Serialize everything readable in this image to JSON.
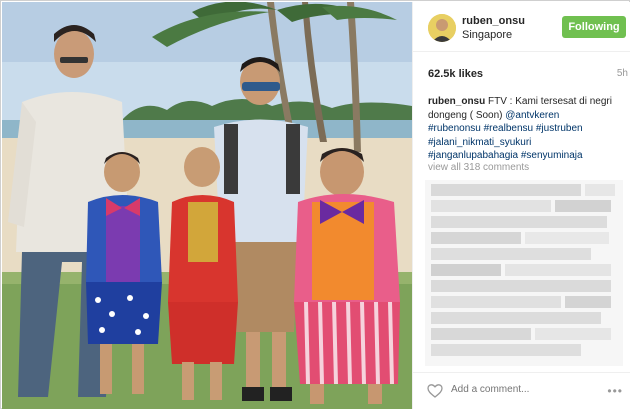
{
  "post": {
    "username": "ruben_onsu",
    "location": "Singapore",
    "follow_label": "Following",
    "likes": "62.5k likes",
    "age": "5h",
    "caption": {
      "user": "ruben_onsu",
      "text": " FTV : Kami tersesat di negri dongeng ( Soon) ",
      "mention": "@antvkeren",
      "tags_line1": "#rubenonsu #realbensu #justruben",
      "tags_line2": "#jalani_nikmati_syukuri",
      "tags_line3": "#janganlupabahagia #senyuminaja"
    },
    "view_all": "view all 318 comments",
    "comment_placeholder": "Add a comment...",
    "more_label": "•••"
  },
  "icons": {
    "heart": "heart-icon",
    "more": "more-options-icon"
  },
  "colors": {
    "follow_button": "#70c050",
    "hashtag": "#003569",
    "muted": "#999999"
  }
}
